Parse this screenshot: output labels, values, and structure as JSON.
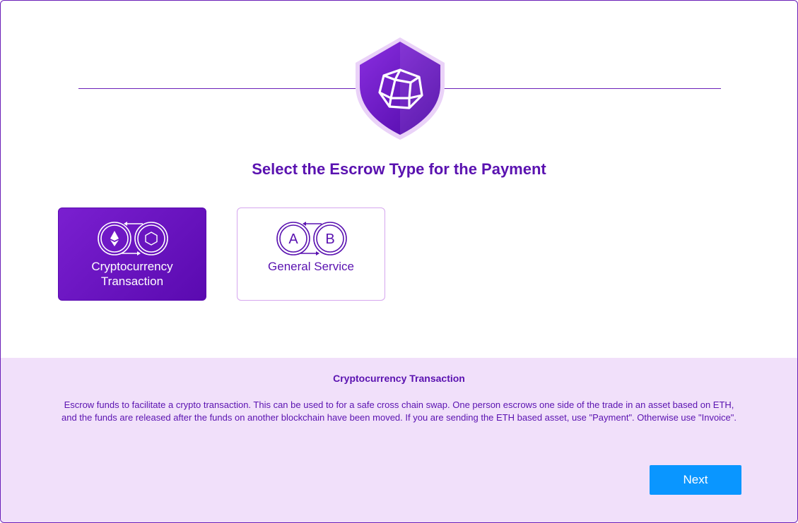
{
  "page": {
    "title": "Select the Escrow Type for the Payment"
  },
  "options": [
    {
      "label": "Cryptocurrency Transaction",
      "icon": "crypto-exchange-icon",
      "selected": true
    },
    {
      "label": "General Service",
      "icon": "ab-exchange-icon",
      "selected": false,
      "icon_letters": [
        "A",
        "B"
      ]
    }
  ],
  "info": {
    "heading": "Cryptocurrency Transaction",
    "description": "Escrow funds to facilitate a crypto transaction. This can be used to for a safe cross chain swap. One person escrows one side of the trade in an asset based on ETH, and the funds are released after the funds on another blockchain have been moved. If you are sending the ETH based asset, use \"Payment\". Otherwise use \"Invoice\"."
  },
  "actions": {
    "next_label": "Next"
  },
  "colors": {
    "accent": "#5a12b0",
    "card_selected": "#6a12c0",
    "info_background": "#f1e0fa",
    "button": "#0a96ff"
  },
  "icons": {
    "logo": "shield-dodecahedron-logo",
    "eth": "ethereum-icon",
    "hexagon": "hexagon-icon"
  }
}
